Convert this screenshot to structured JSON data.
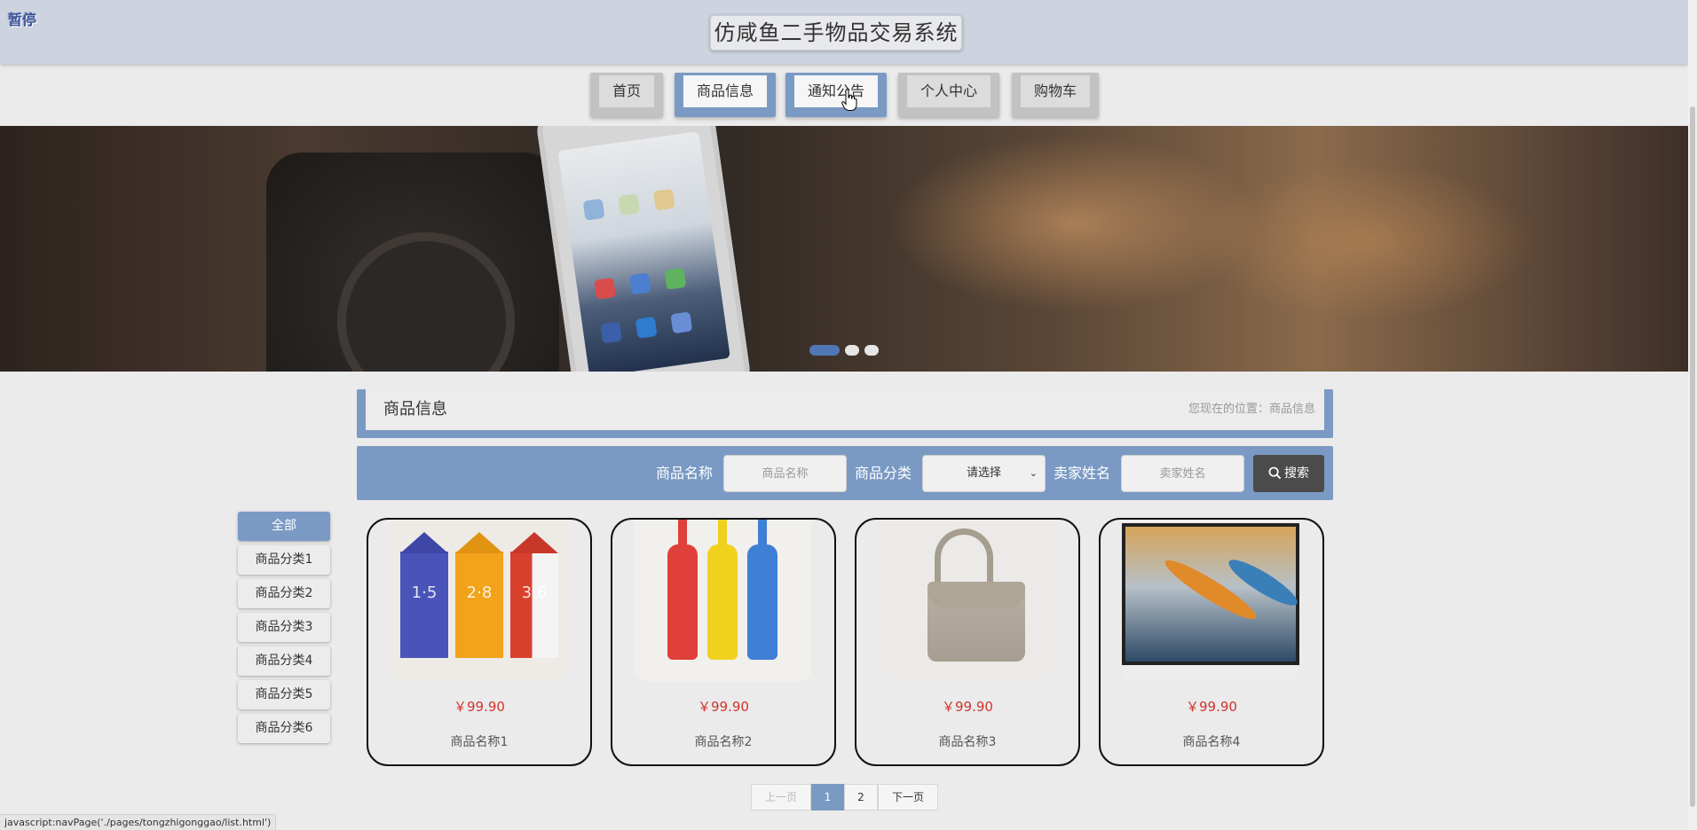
{
  "header": {
    "pause_link": "暂停",
    "site_title": "仿咸鱼二手物品交易系统"
  },
  "nav": [
    {
      "label": "首页",
      "active": false
    },
    {
      "label": "商品信息",
      "active": true
    },
    {
      "label": "通知公告",
      "active": true
    },
    {
      "label": "个人中心",
      "active": false
    },
    {
      "label": "购物车",
      "active": false
    }
  ],
  "banner": {
    "slide_count": 3,
    "active_slide": 1
  },
  "section": {
    "title": "商品信息",
    "breadcrumb_prefix": "您现在的位置：",
    "breadcrumb_current": "商品信息"
  },
  "search": {
    "name_label": "商品名称",
    "name_placeholder": "商品名称",
    "category_label": "商品分类",
    "category_value": "请选择",
    "seller_label": "卖家姓名",
    "seller_placeholder": "卖家姓名",
    "button_label": "搜索"
  },
  "categories": [
    {
      "label": "全部",
      "active": true
    },
    {
      "label": "商品分类1",
      "active": false
    },
    {
      "label": "商品分类2",
      "active": false
    },
    {
      "label": "商品分类3",
      "active": false
    },
    {
      "label": "商品分类4",
      "active": false
    },
    {
      "label": "商品分类5",
      "active": false
    },
    {
      "label": "商品分类6",
      "active": false
    }
  ],
  "products": [
    {
      "price": "￥99.90",
      "name": "商品名称1",
      "image": "milk-cartons"
    },
    {
      "price": "￥99.90",
      "name": "商品名称2",
      "image": "bottles"
    },
    {
      "price": "￥99.90",
      "name": "商品名称3",
      "image": "handbag"
    },
    {
      "price": "￥99.90",
      "name": "商品名称4",
      "image": "tv-kayaks"
    }
  ],
  "carton_numbers": [
    "1·5",
    "2·8",
    "3·6"
  ],
  "pagination": {
    "prev": "上一页",
    "pages": [
      "1",
      "2"
    ],
    "current": "1",
    "next": "下一页"
  },
  "status_bar": "javascript:navPage('./pages/tongzhigonggao/list.html')",
  "colors": {
    "accent": "#7a9ac4",
    "price": "#d0342c",
    "header_bg": "#cdd3df",
    "search_button": "#4b4b4b"
  }
}
